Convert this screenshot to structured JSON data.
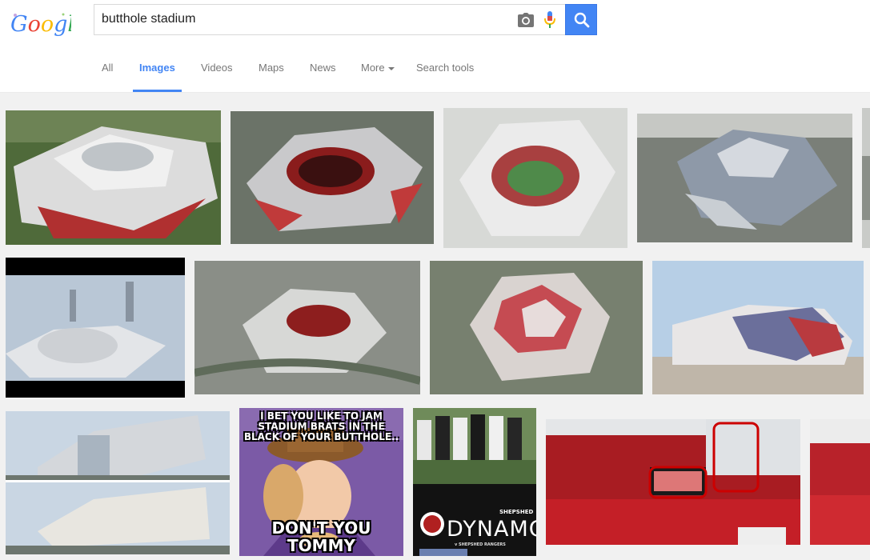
{
  "search": {
    "query": "butthole stadium",
    "placeholder": ""
  },
  "brand": {
    "logo_text": "Google",
    "accent_color": "#4285f4"
  },
  "icons": {
    "camera": "camera-icon",
    "mic": "microphone-icon",
    "search": "magnifier-icon"
  },
  "tabs": [
    {
      "label": "All",
      "active": false
    },
    {
      "label": "Images",
      "active": true
    },
    {
      "label": "Videos",
      "active": false
    },
    {
      "label": "Maps",
      "active": false
    },
    {
      "label": "News",
      "active": false
    },
    {
      "label": "More",
      "active": false
    },
    {
      "label": "Search tools",
      "active": false
    }
  ],
  "results": {
    "meme": {
      "top_text": "I BET YOU LIKE TO JAM STADIUM BRATS IN THE BLACK OF YOUR BUTTHOLE..",
      "bottom_text": "DON'T YOU TOMMY"
    },
    "poster": {
      "title": "DYNAMO",
      "subtitle": "SHEPSHED",
      "caption": "v SHEPSHED RANGERS"
    }
  }
}
